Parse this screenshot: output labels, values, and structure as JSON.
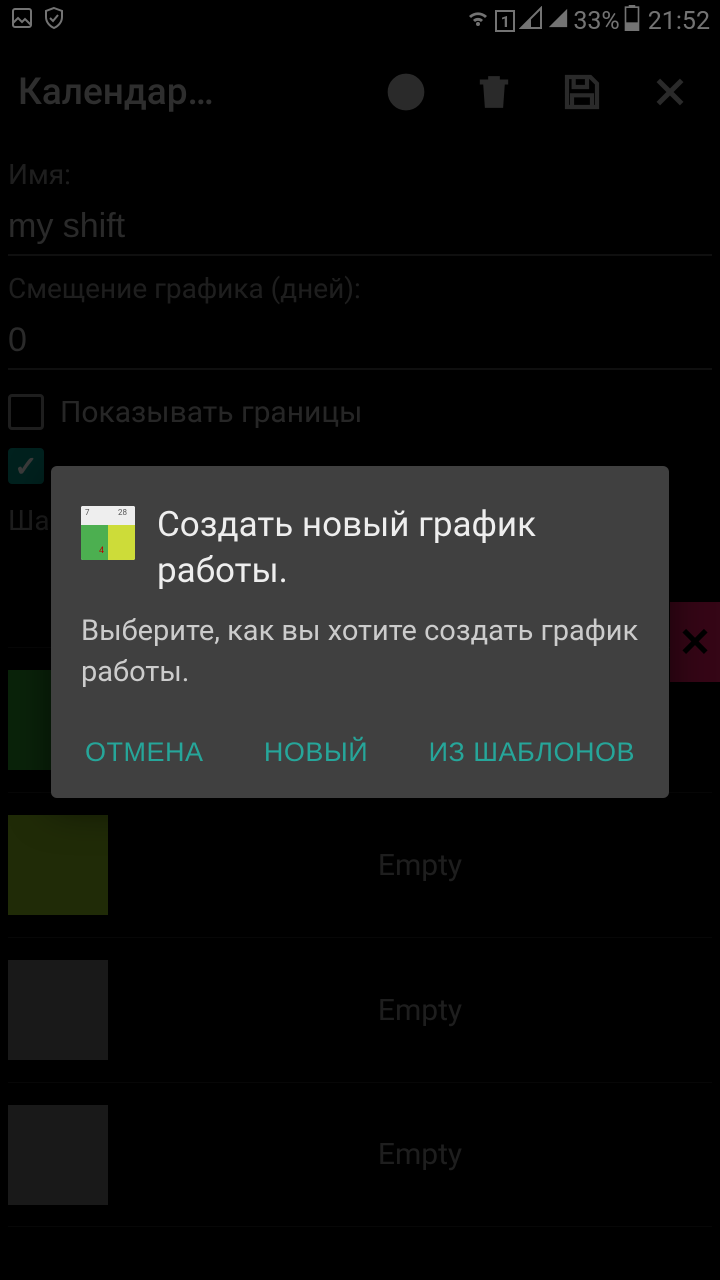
{
  "status": {
    "battery_pct": "33%",
    "time": "21:52",
    "sim": "1"
  },
  "toolbar": {
    "title": "Календар…"
  },
  "fields": {
    "name_label": "Имя:",
    "name_value": "my shift",
    "offset_label": "Смещение графика (дней):",
    "offset_value": "0",
    "show_borders_label": "Показывать границы",
    "templates_label": "Шаб"
  },
  "rows": [
    {
      "color": "#2e9b2e",
      "label": ""
    },
    {
      "color": "#8fbf1f",
      "label": "Empty"
    },
    {
      "color": "#6f6f6f",
      "label": "Empty"
    },
    {
      "color": "#6f6f6f",
      "label": "Empty"
    }
  ],
  "modal": {
    "title": "Создать новый график работы.",
    "body": "Выберите, как вы хотите создать график работы.",
    "cancel": "ОТМЕНА",
    "new": "НОВЫЙ",
    "from_templates": "ИЗ ШАБЛОНОВ"
  }
}
